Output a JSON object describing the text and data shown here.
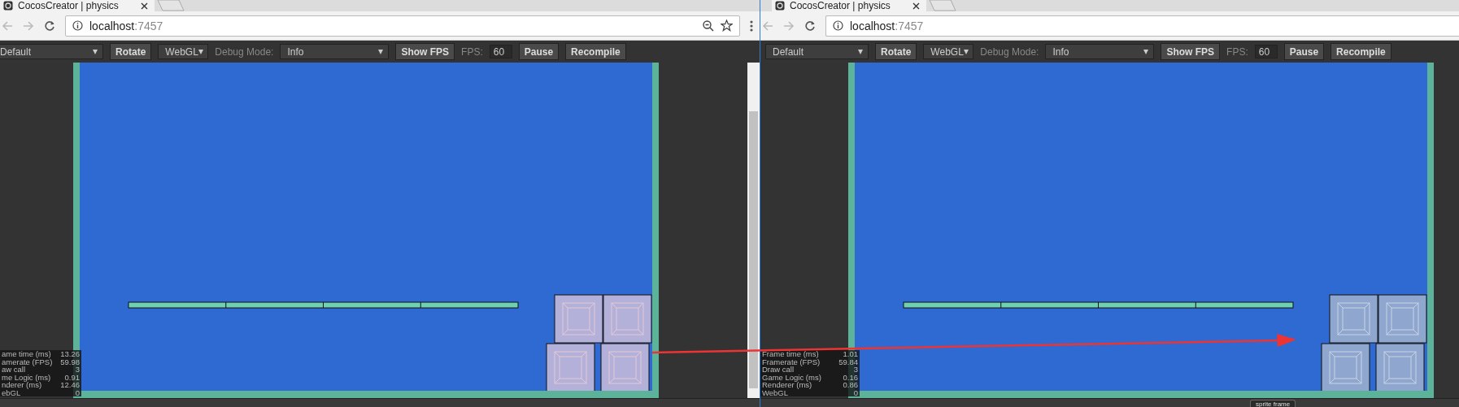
{
  "windows": [
    {
      "tab": {
        "title": "CocosCreator | physics"
      },
      "address": {
        "host": "localhost",
        "port": ":7457"
      },
      "page_actions": true,
      "scrollbar": true,
      "toolbar": {
        "device": "Default",
        "rotate": "Rotate",
        "renderer": "WebGL",
        "debug_label": "Debug Mode:",
        "debug_mode": "Info",
        "show_fps": "Show FPS",
        "fps_label": "FPS:",
        "fps": "60",
        "pause": "Pause",
        "recompile": "Recompile"
      },
      "scene": {
        "tinted": true
      },
      "stats": [
        {
          "label": "ame time (ms)",
          "value": "13.26"
        },
        {
          "label": "amerate (FPS)",
          "value": "59.98"
        },
        {
          "label": "aw call",
          "value": "3"
        },
        {
          "label": "me Logic (ms)",
          "value": "0.91"
        },
        {
          "label": "nderer (ms)",
          "value": "12.46"
        },
        {
          "label": "ebGL",
          "value": "0"
        }
      ]
    },
    {
      "tab": {
        "title": "CocosCreator | physics"
      },
      "address": {
        "host": "localhost",
        "port": ":7457"
      },
      "page_actions": false,
      "scrollbar": false,
      "toolbar": {
        "device": "Default",
        "rotate": "Rotate",
        "renderer": "WebGL",
        "debug_label": "Debug Mode:",
        "debug_mode": "Info",
        "show_fps": "Show FPS",
        "fps_label": "FPS:",
        "fps": "60",
        "pause": "Pause",
        "recompile": "Recompile"
      },
      "scene": {
        "tinted": false
      },
      "stats": [
        {
          "label": "Frame time (ms)",
          "value": "1.01"
        },
        {
          "label": "Framerate (FPS)",
          "value": "59.84"
        },
        {
          "label": "Draw call",
          "value": "3"
        },
        {
          "label": "Game Logic (ms)",
          "value": "0.16"
        },
        {
          "label": "Renderer (ms)",
          "value": "0.86"
        },
        {
          "label": "WebGL",
          "value": "0"
        }
      ],
      "panel_tab": "sprite frame"
    }
  ]
}
